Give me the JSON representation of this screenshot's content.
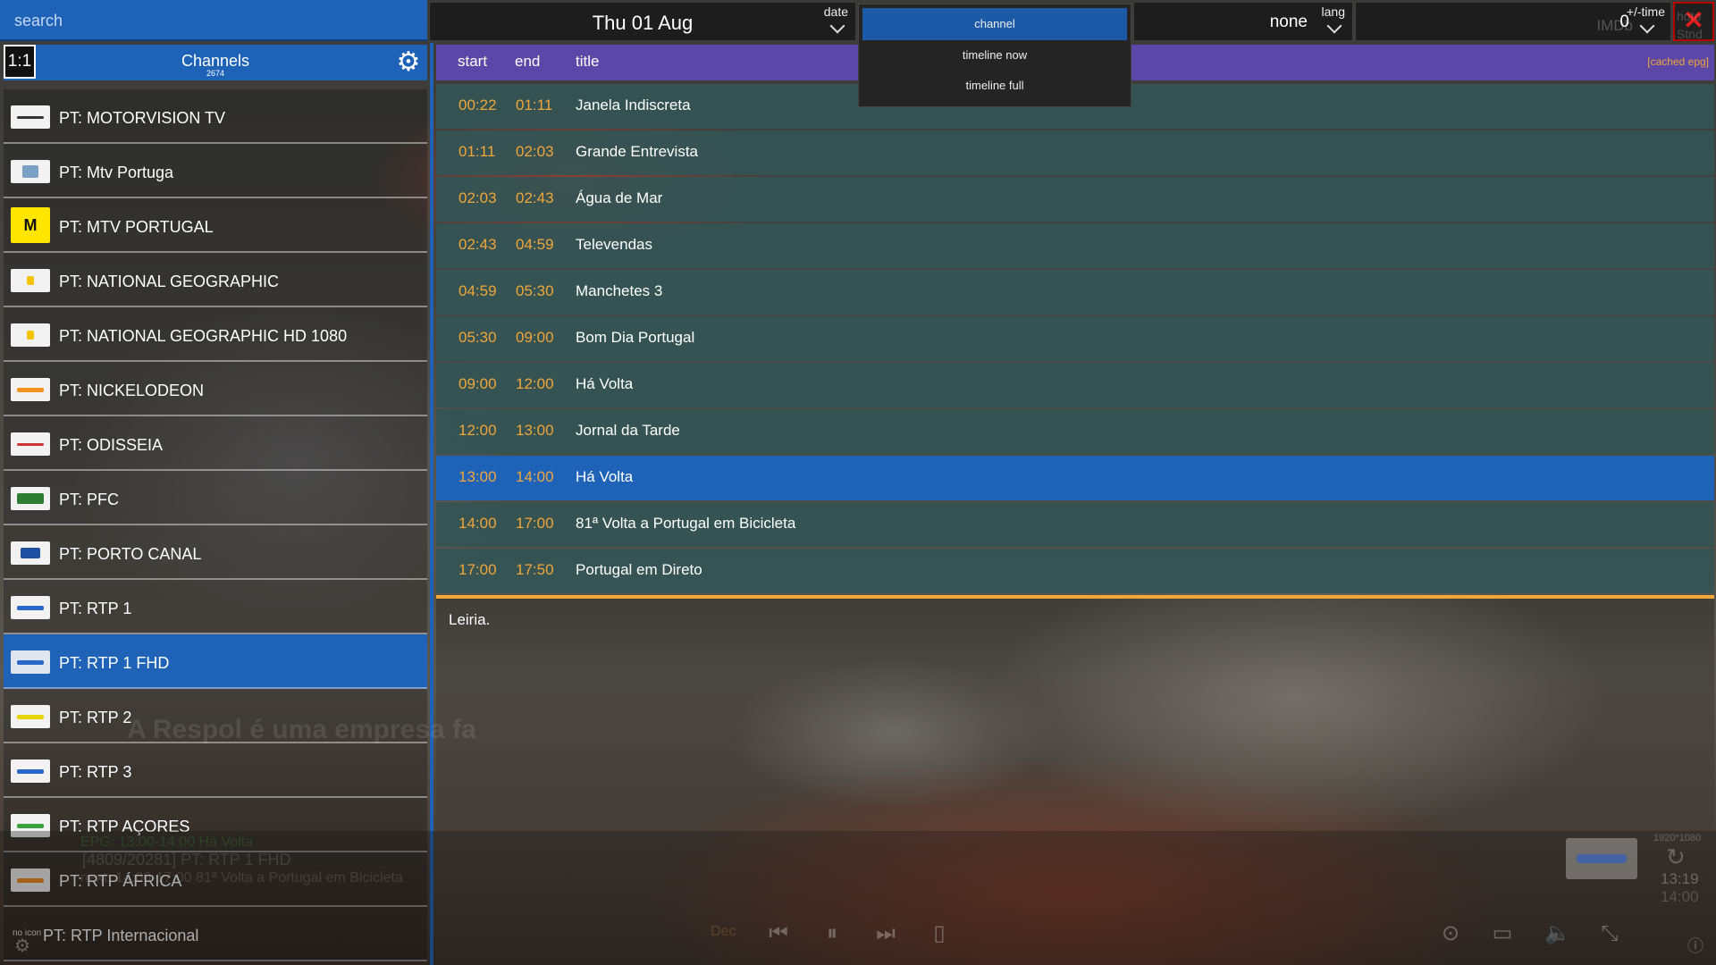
{
  "search": {
    "placeholder": "search"
  },
  "date": {
    "label": "date",
    "value": "Thu 01 Aug"
  },
  "view_menu": {
    "items": [
      "channel",
      "timeline now",
      "timeline full"
    ],
    "selected": "channel"
  },
  "lang": {
    "label": "lang",
    "value": "none"
  },
  "time_offset": {
    "label": "+/-time",
    "value": "0"
  },
  "channels_panel": {
    "ratio": "1:1",
    "title": "Channels",
    "count": "2674",
    "items": [
      {
        "name": "PT: MOTORVISION TV",
        "logo": "motorvision-logo"
      },
      {
        "name": "PT: Mtv Portuga",
        "logo": "mtv-portuga-logo"
      },
      {
        "name": "PT: MTV PORTUGAL",
        "logo": "mtv-logo"
      },
      {
        "name": "PT: NATIONAL GEOGRAPHIC",
        "logo": "natgeo-logo"
      },
      {
        "name": "PT: NATIONAL GEOGRAPHIC HD 1080",
        "logo": "natgeo-hd-logo"
      },
      {
        "name": "PT: NICKELODEON",
        "logo": "nickelodeon-logo"
      },
      {
        "name": "PT: ODISSEIA",
        "logo": "odisseia-logo"
      },
      {
        "name": "PT: PFC",
        "logo": "pfc-logo"
      },
      {
        "name": "PT: PORTO CANAL",
        "logo": "porto-canal-logo"
      },
      {
        "name": "PT: RTP 1",
        "logo": "rtp1-logo"
      },
      {
        "name": "PT: RTP 1 FHD",
        "logo": "rtp1-logo",
        "selected": true
      },
      {
        "name": "PT: RTP 2",
        "logo": "rtp2-logo"
      },
      {
        "name": "PT: RTP 3",
        "logo": "rtp3-logo"
      },
      {
        "name": "PT: RTP AÇORES",
        "logo": "rtp-acores-logo"
      },
      {
        "name": "PT: RTP ÁFRICA",
        "logo": "rtp-africa-logo"
      },
      {
        "name": "PT: RTP Internacional",
        "logo": "no icon"
      }
    ]
  },
  "epg": {
    "headers": {
      "start": "start",
      "end": "end",
      "title": "title"
    },
    "cached": "[cached epg]",
    "rows": [
      {
        "start": "00:22",
        "end": "01:11",
        "title": "Janela Indiscreta"
      },
      {
        "start": "01:11",
        "end": "02:03",
        "title": "Grande Entrevista"
      },
      {
        "start": "02:03",
        "end": "02:43",
        "title": "Água de Mar"
      },
      {
        "start": "02:43",
        "end": "04:59",
        "title": "Televendas"
      },
      {
        "start": "04:59",
        "end": "05:30",
        "title": "Manchetes 3"
      },
      {
        "start": "05:30",
        "end": "09:00",
        "title": "Bom Dia Portugal"
      },
      {
        "start": "09:00",
        "end": "12:00",
        "title": "Há Volta"
      },
      {
        "start": "12:00",
        "end": "13:00",
        "title": "Jornal da Tarde"
      },
      {
        "start": "13:00",
        "end": "14:00",
        "title": "Há Volta",
        "selected": true
      },
      {
        "start": "14:00",
        "end": "17:00",
        "title": "81ª Volta a Portugal em Bicicleta"
      },
      {
        "start": "17:00",
        "end": "17:50",
        "title": "Portugal em Direto"
      }
    ],
    "description": "Leiria."
  },
  "player_overlay": {
    "subtitle": "A Respol é uma empresa fa",
    "epg_now": "EPG: 13:00-14:00 Há Volta",
    "channel_line": "[4809/20281] PT: RTP 1 FHD",
    "next": "next: 14:00-17:00 81ª Volta a Portugal em Bicicleta",
    "resolution": "1920*1080",
    "clock": "13:19",
    "end_time": "14:00",
    "decoder": "Dec",
    "side_label": "hoto",
    "side_label2": "Stnd",
    "imdb": "IMDb"
  },
  "colors": {
    "accent": "#1f63b8",
    "epg_header": "#5a47a8",
    "row": "#345454",
    "time": "#f0a63a",
    "close": "#e01b1b"
  }
}
